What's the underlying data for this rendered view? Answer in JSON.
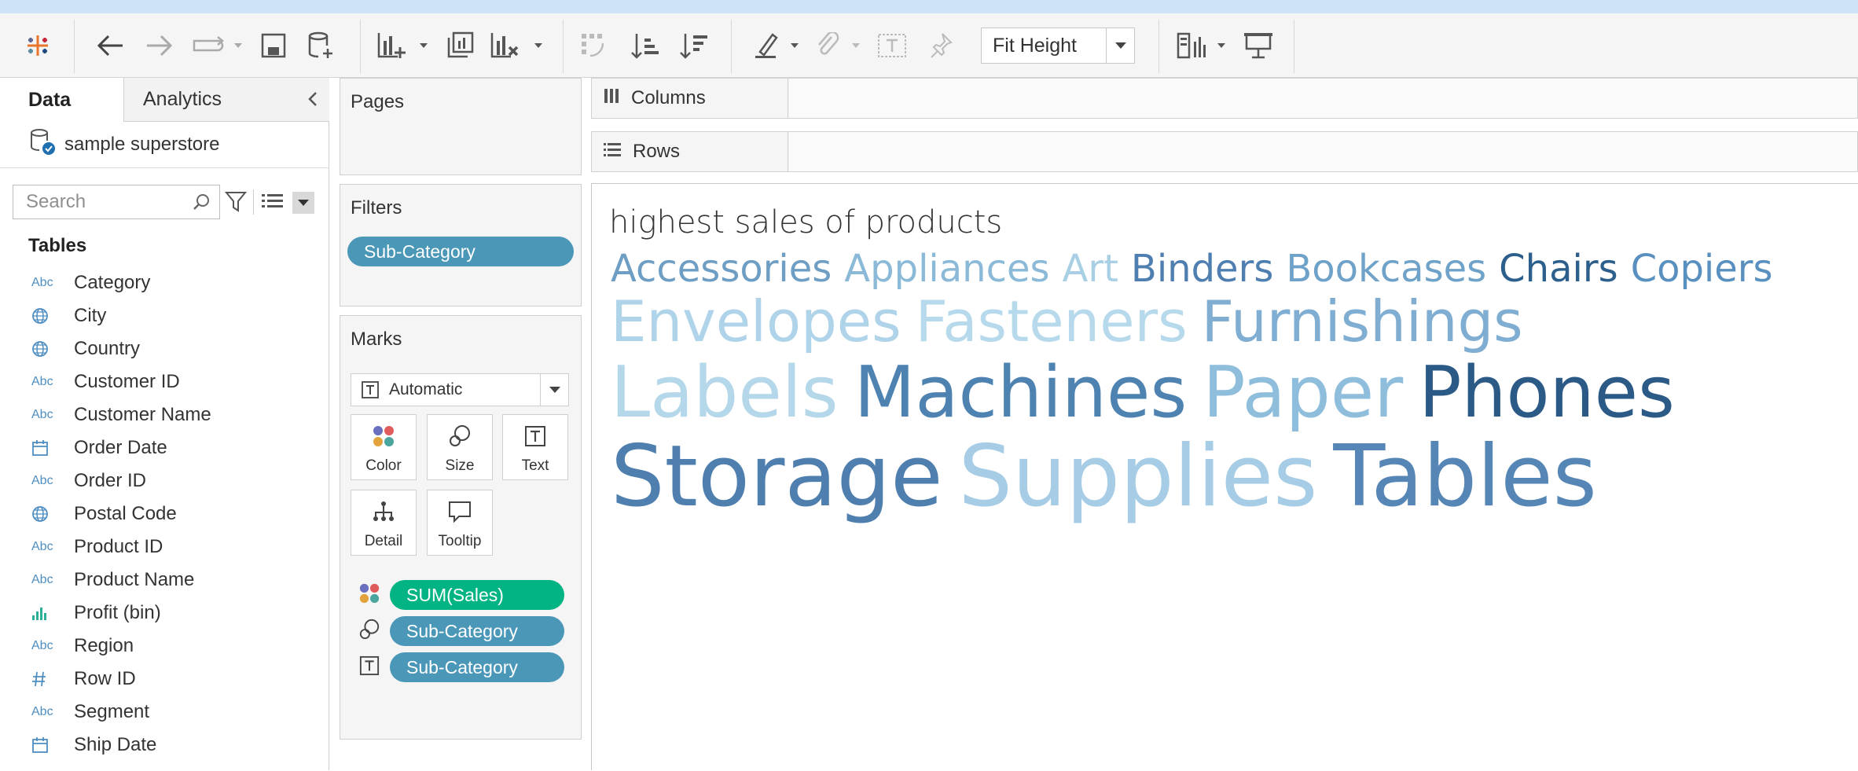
{
  "toolbar": {
    "icons": [
      "tableau-logo-icon",
      "undo-icon",
      "redo-icon",
      "replay-icon",
      "save-icon",
      "new-datasource-icon",
      "new-worksheet-icon",
      "duplicate-icon",
      "clear-sheet-icon",
      "swap-icon",
      "sort-ascending-icon",
      "sort-descending-icon",
      "highlight-icon",
      "group-icon",
      "show-labels-icon",
      "fix-axes-icon",
      "show-me-icon",
      "presentation-icon"
    ],
    "fit_value": "Fit Height"
  },
  "data_pane": {
    "tab_data": "Data",
    "tab_analytics": "Analytics",
    "datasource": "sample superstore",
    "search_placeholder": "Search",
    "tables_heading": "Tables",
    "fields": [
      {
        "name": "Category",
        "type": "Abc"
      },
      {
        "name": "City",
        "type": "geo"
      },
      {
        "name": "Country",
        "type": "geo"
      },
      {
        "name": "Customer ID",
        "type": "Abc"
      },
      {
        "name": "Customer Name",
        "type": "Abc"
      },
      {
        "name": "Order Date",
        "type": "date"
      },
      {
        "name": "Order ID",
        "type": "Abc"
      },
      {
        "name": "Postal Code",
        "type": "geo"
      },
      {
        "name": "Product ID",
        "type": "Abc"
      },
      {
        "name": "Product Name",
        "type": "Abc"
      },
      {
        "name": "Profit (bin)",
        "type": "bin"
      },
      {
        "name": "Region",
        "type": "Abc"
      },
      {
        "name": "Row ID",
        "type": "num"
      },
      {
        "name": "Segment",
        "type": "Abc"
      },
      {
        "name": "Ship Date",
        "type": "date"
      }
    ]
  },
  "cards": {
    "pages_title": "Pages",
    "filters_title": "Filters",
    "filter_pill": "Sub-Category",
    "marks_title": "Marks",
    "mark_type": "Automatic",
    "buttons": {
      "color": "Color",
      "size": "Size",
      "text": "Text",
      "detail": "Detail",
      "tooltip": "Tooltip"
    },
    "mark_pills": [
      "SUM(Sales)",
      "Sub-Category",
      "Sub-Category"
    ]
  },
  "shelves": {
    "columns": "Columns",
    "rows": "Rows"
  },
  "view": {
    "title": "highest sales of products"
  },
  "chart_data": {
    "type": "word-cloud",
    "title": "highest sales of products",
    "words": [
      {
        "text": "Accessories",
        "rank": 6,
        "color": "#6e9ec4"
      },
      {
        "text": "Appliances",
        "rank": 6,
        "color": "#8bb9d8"
      },
      {
        "text": "Art",
        "rank": 6,
        "color": "#a9cfe4"
      },
      {
        "text": "Binders",
        "rank": 6,
        "color": "#4f7fb0"
      },
      {
        "text": "Bookcases",
        "rank": 6,
        "color": "#6fa2c8"
      },
      {
        "text": "Chairs",
        "rank": 6,
        "color": "#2d5f8d"
      },
      {
        "text": "Copiers",
        "rank": 6,
        "color": "#5990bf"
      },
      {
        "text": "Envelopes",
        "rank": 5,
        "color": "#afd3e8"
      },
      {
        "text": "Fasteners",
        "rank": 5,
        "color": "#b7d9ec"
      },
      {
        "text": "Furnishings",
        "rank": 5,
        "color": "#7faed2"
      },
      {
        "text": "Labels",
        "rank": 4,
        "color": "#b4d7ea"
      },
      {
        "text": "Machines",
        "rank": 4,
        "color": "#4d82b1"
      },
      {
        "text": "Paper",
        "rank": 4,
        "color": "#8fbedc"
      },
      {
        "text": "Phones",
        "rank": 4,
        "color": "#2b5a87"
      },
      {
        "text": "Storage",
        "rank": 3,
        "color": "#4f7fae"
      },
      {
        "text": "Supplies",
        "rank": 3,
        "color": "#a6cde5"
      },
      {
        "text": "Tables",
        "rank": 3,
        "color": "#5686b5"
      }
    ]
  }
}
